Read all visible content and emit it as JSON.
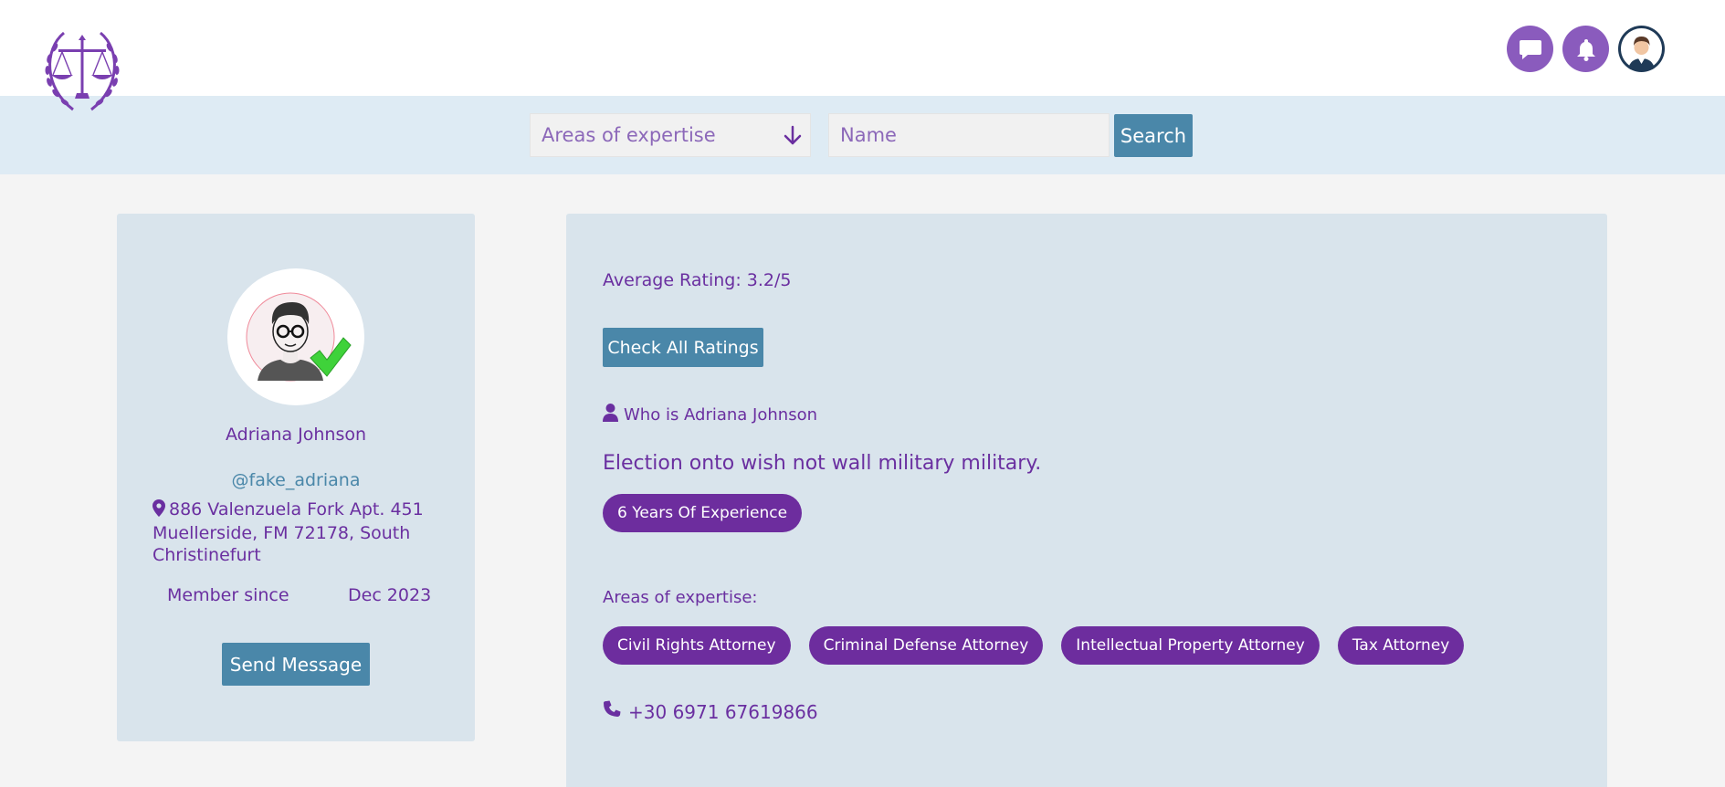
{
  "header": {
    "logo_icon": "scales-of-justice-laurel-logo",
    "messages_icon": "chat-icon",
    "notifications_icon": "bell-icon",
    "user_avatar": "avatar"
  },
  "search": {
    "expertise_placeholder": "Areas of expertise",
    "name_placeholder": "Name",
    "button_label": "Search"
  },
  "profile": {
    "name": "Adriana Johnson",
    "handle": "@fake_adriana",
    "address": "886 Valenzuela Fork Apt. 451 Muellerside, FM 72178, South Christinefurt",
    "member_since_label": "Member since",
    "member_since_value": "Dec 2023",
    "send_message_label": "Send Message",
    "verified": true
  },
  "details": {
    "rating_text": "Average Rating: 3.2/5",
    "check_ratings_label": "Check All Ratings",
    "who_is_text": "Who is Adriana Johnson",
    "bio": "Election onto wish not wall military military.",
    "experience": "6 Years Of Experience",
    "areas_label": "Areas of expertise:",
    "areas": [
      "Civil Rights Attorney",
      "Criminal Defense Attorney",
      "Intellectual Property Attorney",
      "Tax Attorney"
    ],
    "phone": "+30 6971 67619866"
  },
  "colors": {
    "accent_purple": "#6d2d9e",
    "button_blue": "#4a87a9",
    "card_bg": "#d9e4ec",
    "search_band": "#deebf4"
  }
}
